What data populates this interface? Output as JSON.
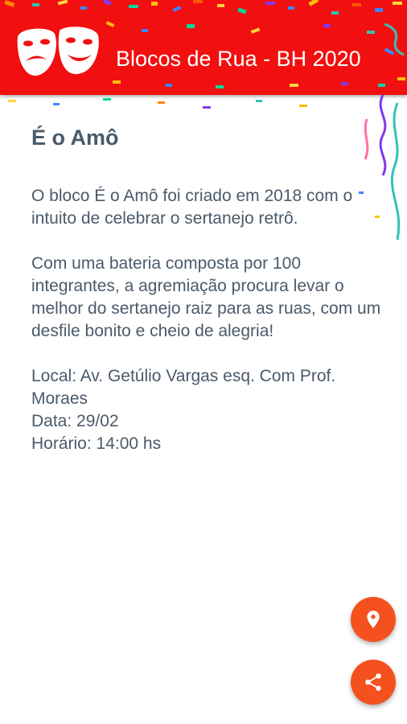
{
  "app_bar": {
    "title": "Blocos de Rua - BH 2020",
    "logo_icon": "theater-masks-icon",
    "background_color": "#f20f0f"
  },
  "bloco": {
    "name": "É o Amô",
    "description": "O bloco É o Amô foi criado em 2018 com o intuito de celebrar o sertanejo retrô.\n\nCom uma bateria composta por 100 integrantes, a agremiação procura levar o melhor do sertanejo raiz para as ruas, com um desfile bonito e cheio de alegria!\n\nLocal: Av. Getúlio Vargas esq. Com Prof. Moraes\nData: 29/02\nHorário: 14:00 hs"
  },
  "actions": {
    "location_icon": "location-pin-icon",
    "share_icon": "share-icon",
    "accent_color": "#f4511e"
  }
}
